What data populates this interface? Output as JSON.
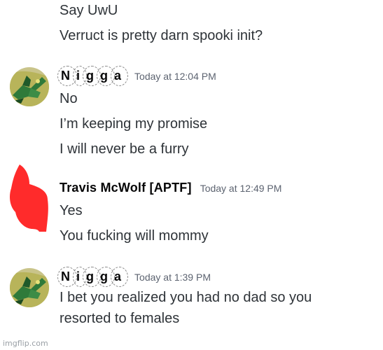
{
  "messages_top": {
    "line1": "Say UwU",
    "line2": "Verruct is pretty darn spooki init?"
  },
  "group1": {
    "username_chars": [
      "N",
      "i",
      "g",
      "g",
      "a"
    ],
    "timestamp": "Today at 12:04 PM",
    "lines": [
      "No",
      "I’m keeping my promise",
      "I will never be a furry"
    ]
  },
  "group2": {
    "username": "Travis McWolf [APTF]",
    "timestamp": "Today at 12:49 PM",
    "lines": [
      "Yes",
      "You fucking will mommy"
    ]
  },
  "group3": {
    "username_chars": [
      "N",
      "i",
      "g",
      "g",
      "a"
    ],
    "timestamp": "Today at 1:39 PM",
    "lines": [
      "I bet you realized you had no dad so you",
      "resorted to females"
    ]
  },
  "watermark": "imgflip.com",
  "colors": {
    "text": "#2e3338",
    "username": "#060607",
    "timestamp": "#5c6370",
    "censor_red": "#ff2b2b",
    "avatar_green": "#2f7a3a",
    "avatar_yellow": "#c9b84a"
  }
}
